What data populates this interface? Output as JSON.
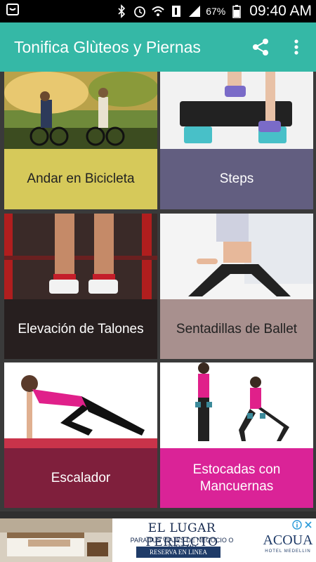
{
  "status_bar": {
    "battery_percent": "67%",
    "time": "09:40 AM",
    "icons": [
      "notification-icon",
      "bluetooth-icon",
      "alarm-icon",
      "wifi-icon",
      "sim-icon",
      "signal-icon",
      "battery-icon"
    ]
  },
  "app_bar": {
    "title": "Tonifica Glùteos y Piernas",
    "color": "#35b8a6",
    "actions": [
      "share-icon",
      "overflow-menu-icon"
    ]
  },
  "exercises": [
    {
      "label": "Andar en Bicicleta",
      "label_color": "#d6c95a",
      "text_color": "#222222"
    },
    {
      "label": "Steps",
      "label_color": "#625e80",
      "text_color": "#ffffff"
    },
    {
      "label": "Elevación de Talones",
      "label_color": "#271f1f",
      "text_color": "#ffffff"
    },
    {
      "label": "Sentadillas de Ballet",
      "label_color": "#a8908e",
      "text_color": "#222222"
    },
    {
      "label": "Escalador",
      "label_color": "#7f1f3c",
      "text_color": "#ffffff"
    },
    {
      "label": "Estocadas con Mancuernas",
      "label_color": "#da2397",
      "text_color": "#ffffff"
    }
  ],
  "ad": {
    "headline": "EL LUGAR PERFECTO",
    "subline": "PARA TUS VIAJES DE NEGOCIO O TURISMO",
    "cta": "RESERVA EN LINEA",
    "brand": "ACOUA",
    "brand_sub": "HOTEL MEDELLIN"
  }
}
